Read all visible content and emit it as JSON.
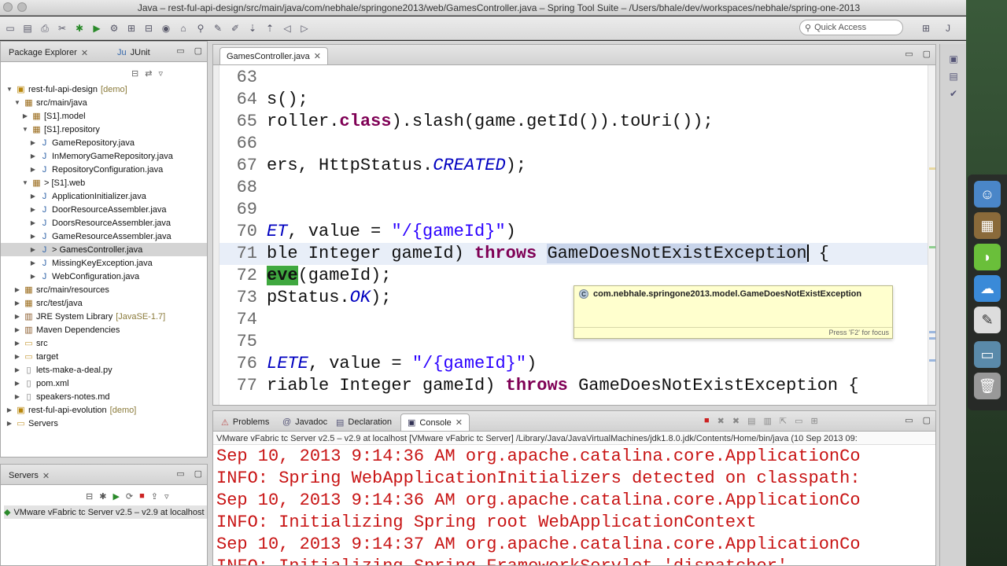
{
  "window": {
    "title": "Java – rest-ful-api-design/src/main/java/com/nebhale/springone2013/web/GamesController.java – Spring Tool Suite – /Users/bhale/dev/workspaces/nebhale/spring-one-2013"
  },
  "toolbar": {
    "quick_access_placeholder": "Quick Access"
  },
  "package_explorer": {
    "tabs": [
      {
        "label": "Package Explorer",
        "active": true
      },
      {
        "label": "JUnit",
        "active": false
      }
    ],
    "tree": [
      {
        "label": "rest-ful-api-design",
        "decoration": "[demo]",
        "expanded": true,
        "icon": "project-icon"
      },
      {
        "label": "src/main/java",
        "expanded": true,
        "icon": "source-folder-icon"
      },
      {
        "label": "[S1].model",
        "expanded": false,
        "icon": "package-icon"
      },
      {
        "label": "[S1].repository",
        "expanded": true,
        "icon": "package-icon"
      },
      {
        "label": "GameRepository.java",
        "expanded": false,
        "icon": "java-file-icon"
      },
      {
        "label": "InMemoryGameRepository.java",
        "expanded": false,
        "icon": "java-file-icon"
      },
      {
        "label": "RepositoryConfiguration.java",
        "expanded": false,
        "icon": "java-file-icon"
      },
      {
        "label": "> [S1].web",
        "expanded": true,
        "icon": "package-icon"
      },
      {
        "label": "ApplicationInitializer.java",
        "expanded": false,
        "icon": "java-file-icon"
      },
      {
        "label": "DoorResourceAssembler.java",
        "expanded": false,
        "icon": "java-file-icon"
      },
      {
        "label": "DoorsResourceAssembler.java",
        "expanded": false,
        "icon": "java-file-icon"
      },
      {
        "label": "GameResourceAssembler.java",
        "expanded": false,
        "icon": "java-file-icon"
      },
      {
        "label": "> GamesController.java",
        "expanded": false,
        "icon": "java-file-icon",
        "selected": true
      },
      {
        "label": "MissingKeyException.java",
        "expanded": false,
        "icon": "java-file-icon"
      },
      {
        "label": "WebConfiguration.java",
        "expanded": false,
        "icon": "java-file-icon"
      },
      {
        "label": "src/main/resources",
        "expanded": false,
        "icon": "source-folder-icon"
      },
      {
        "label": "src/test/java",
        "expanded": false,
        "icon": "source-folder-icon"
      },
      {
        "label": "JRE System Library",
        "decoration": "[JavaSE-1.7]",
        "expanded": false,
        "icon": "library-icon"
      },
      {
        "label": "Maven Dependencies",
        "expanded": false,
        "icon": "library-icon"
      },
      {
        "label": "src",
        "expanded": false,
        "icon": "folder-icon"
      },
      {
        "label": "target",
        "expanded": false,
        "icon": "folder-icon"
      },
      {
        "label": "lets-make-a-deal.py",
        "expanded": false,
        "icon": "file-icon"
      },
      {
        "label": "pom.xml",
        "expanded": false,
        "icon": "file-icon"
      },
      {
        "label": "speakers-notes.md",
        "expanded": false,
        "icon": "file-icon"
      },
      {
        "label": "rest-ful-api-evolution",
        "decoration": "[demo]",
        "expanded": false,
        "icon": "project-icon"
      },
      {
        "label": "Servers",
        "expanded": false,
        "icon": "folder-icon"
      }
    ]
  },
  "servers_view": {
    "tab_label": "Servers",
    "server": "VMware vFabric tc Server v2.5 – v2.9 at localhost"
  },
  "editor": {
    "tab_label": "GamesController.java",
    "lines": [
      {
        "n": "63",
        "segs": []
      },
      {
        "n": "64",
        "segs": [
          {
            "t": "s();",
            "c": ""
          }
        ]
      },
      {
        "n": "65",
        "segs": [
          {
            "t": "roller.",
            "c": ""
          },
          {
            "t": "class",
            "c": "kw"
          },
          {
            "t": ").slash(game.getId()).toUri());",
            "c": ""
          }
        ]
      },
      {
        "n": "66",
        "segs": []
      },
      {
        "n": "67",
        "segs": [
          {
            "t": "ers, HttpStatus.",
            "c": ""
          },
          {
            "t": "CREATED",
            "c": "const"
          },
          {
            "t": ");",
            "c": ""
          }
        ]
      },
      {
        "n": "68",
        "segs": []
      },
      {
        "n": "69",
        "segs": []
      },
      {
        "n": "70",
        "segs": [
          {
            "t": "ET",
            "c": "const"
          },
          {
            "t": ", value = ",
            "c": ""
          },
          {
            "t": "\"/{gameId}\"",
            "c": "str"
          },
          {
            "t": ")",
            "c": ""
          }
        ]
      },
      {
        "n": "71",
        "segs": [
          {
            "t": "ble Integer gameId) ",
            "c": ""
          },
          {
            "t": "throws",
            "c": "kw"
          },
          {
            "t": " ",
            "c": ""
          },
          {
            "t": "GameDoesNotExistException",
            "c": "sel"
          },
          {
            "t": "",
            "c": "caret"
          },
          {
            "t": " {",
            "c": ""
          }
        ],
        "current": true
      },
      {
        "n": "72",
        "segs": [
          {
            "t": "eve",
            "c": "hl"
          },
          {
            "t": "(gameId);",
            "c": ""
          }
        ]
      },
      {
        "n": "73",
        "segs": [
          {
            "t": "pStatus.",
            "c": ""
          },
          {
            "t": "OK",
            "c": "const"
          },
          {
            "t": ");",
            "c": ""
          }
        ]
      },
      {
        "n": "74",
        "segs": []
      },
      {
        "n": "75",
        "segs": []
      },
      {
        "n": "76",
        "segs": [
          {
            "t": "LETE",
            "c": "const"
          },
          {
            "t": ", value = ",
            "c": ""
          },
          {
            "t": "\"/{gameId}\"",
            "c": "str"
          },
          {
            "t": ")",
            "c": ""
          }
        ]
      },
      {
        "n": "77",
        "segs": [
          {
            "t": "riable Integer gameId) ",
            "c": ""
          },
          {
            "t": "throws",
            "c": "kw"
          },
          {
            "t": " GameDoesNotExistException {",
            "c": ""
          }
        ]
      }
    ],
    "hover": {
      "text": "com.nebhale.springone2013.model.GameDoesNotExistException",
      "footer": "Press 'F2' for focus"
    }
  },
  "bottom_panel": {
    "tabs": [
      {
        "label": "Problems",
        "active": false,
        "icon": "problems-icon"
      },
      {
        "label": "Javadoc",
        "active": false,
        "icon": "javadoc-icon"
      },
      {
        "label": "Declaration",
        "active": false,
        "icon": "declaration-icon"
      },
      {
        "label": "Console",
        "active": true,
        "icon": "console-icon"
      }
    ],
    "console_header": "VMware vFabric tc Server v2.5 – v2.9 at localhost [VMware vFabric tc Server] /Library/Java/JavaVirtualMachines/jdk1.8.0.jdk/Contents/Home/bin/java (10 Sep 2013 09:",
    "lines": [
      "Sep 10, 2013 9:14:36 AM org.apache.catalina.core.ApplicationCo",
      "INFO: Spring WebApplicationInitializers detected on classpath:",
      "Sep 10, 2013 9:14:36 AM org.apache.catalina.core.ApplicationCo",
      "INFO: Initializing Spring root WebApplicationContext",
      "Sep 10, 2013 9:14:37 AM org.apache.catalina.core.ApplicationCo",
      "INFO: Initializing Spring FrameworkServlet 'dispatcher'"
    ]
  },
  "colors": {
    "keyword": "#7f0055",
    "string": "#2a00ff",
    "constant": "#0000c0",
    "console_text": "#c81414",
    "hover_bg": "#ffffce",
    "occurrence_highlight": "#3fa83f"
  }
}
